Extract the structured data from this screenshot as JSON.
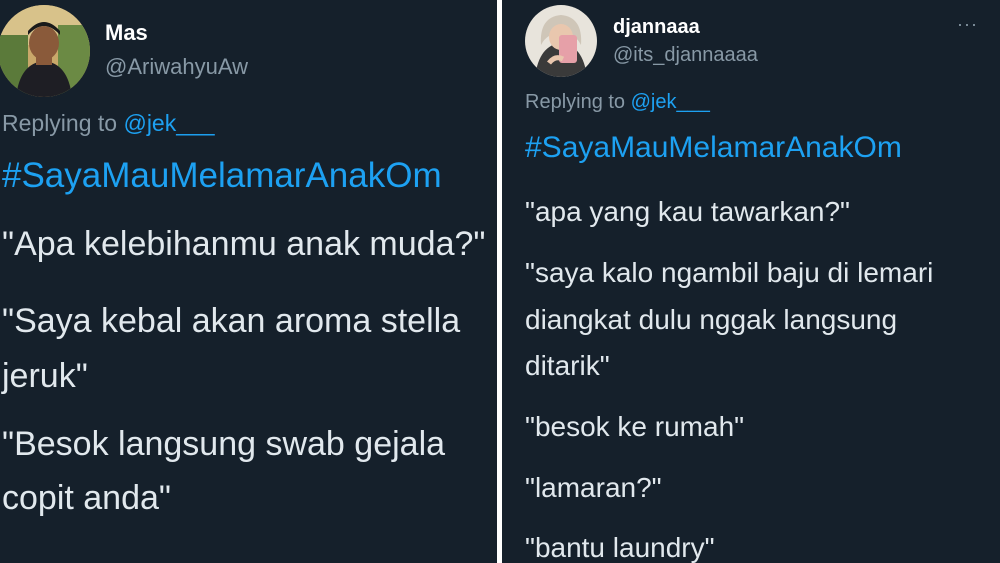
{
  "left_tweet": {
    "display_name": "Mas",
    "handle": "@AriwahyuAw",
    "reply_prefix": "Replying to ",
    "reply_mention": "@jek___",
    "hashtag": "#SayaMauMelamarAnakOm",
    "lines": [
      "\"Apa kelebihanmu anak muda?\"",
      "\"Saya kebal akan aroma stella",
      "jeruk\"",
      "\"Besok langsung swab gejala",
      "copit anda\""
    ]
  },
  "right_tweet": {
    "display_name": "djannaaa",
    "handle": "@its_djannaaaa",
    "more_icon": "···",
    "reply_prefix": "Replying to ",
    "reply_mention": "@jek___",
    "hashtag": "#SayaMauMelamarAnakOm",
    "lines": [
      "\"apa yang kau tawarkan?\"",
      "\"saya kalo ngambil baju di lemari",
      "diangkat dulu nggak langsung",
      "ditarik\"",
      "\"besok ke rumah\"",
      "\"lamaran?\"",
      "\"bantu laundry\""
    ]
  },
  "colors": {
    "background": "#15202b",
    "accent": "#1da1f2",
    "secondary_text": "#8899a6",
    "primary_text": "#e1e8ed",
    "separator": "#ffffff"
  }
}
